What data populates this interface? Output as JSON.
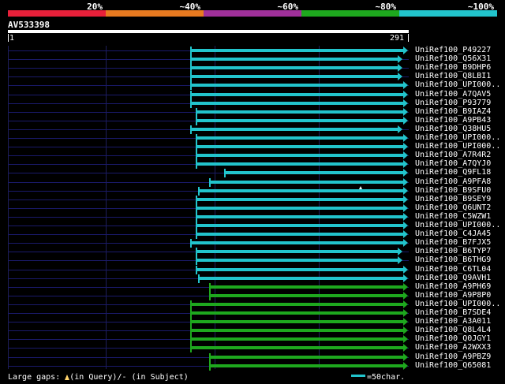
{
  "legend": {
    "segments": [
      {
        "label": "20%",
        "color": "#e8203a"
      },
      {
        "label": "~40%",
        "color": "#e87a20"
      },
      {
        "label": "~60%",
        "color": "#a0309a"
      },
      {
        "label": "~80%",
        "color": "#1ea81e"
      },
      {
        "label": "~100%",
        "color": "#22c4cc"
      }
    ]
  },
  "query": {
    "name": "AV533398",
    "start": "1",
    "end": "291"
  },
  "hits": [
    {
      "name": "UniRef100_P49227",
      "start": 133,
      "end": 291,
      "color": "cyan"
    },
    {
      "name": "UniRef100_Q56X31",
      "start": 133,
      "end": 287,
      "color": "cyan"
    },
    {
      "name": "UniRef100_B9DHP6",
      "start": 133,
      "end": 287,
      "color": "cyan"
    },
    {
      "name": "UniRef100_Q8LBI1",
      "start": 133,
      "end": 287,
      "color": "cyan"
    },
    {
      "name": "UniRef100_UPI000..",
      "start": 133,
      "end": 291,
      "color": "cyan"
    },
    {
      "name": "UniRef100_A7QAV5",
      "start": 133,
      "end": 291,
      "color": "cyan"
    },
    {
      "name": "UniRef100_P93779",
      "start": 133,
      "end": 291,
      "color": "cyan"
    },
    {
      "name": "UniRef100_B9IAZ4",
      "start": 137,
      "end": 291,
      "color": "cyan"
    },
    {
      "name": "UniRef100_A9PB43",
      "start": 137,
      "end": 291,
      "color": "cyan"
    },
    {
      "name": "UniRef100_Q38HU5",
      "start": 133,
      "end": 287,
      "color": "cyan"
    },
    {
      "name": "UniRef100_UPI000..",
      "start": 137,
      "end": 291,
      "color": "cyan"
    },
    {
      "name": "UniRef100_UPI000..",
      "start": 137,
      "end": 291,
      "color": "cyan"
    },
    {
      "name": "UniRef100_A7R4R2",
      "start": 137,
      "end": 291,
      "color": "cyan"
    },
    {
      "name": "UniRef100_A7QYJ0",
      "start": 137,
      "end": 291,
      "color": "cyan"
    },
    {
      "name": "UniRef100_Q9FL18",
      "start": 158,
      "end": 291,
      "color": "cyan"
    },
    {
      "name": "UniRef100_A9PFA8",
      "start": 147,
      "end": 291,
      "color": "cyan"
    },
    {
      "name": "UniRef100_B9SFU0",
      "start": 139,
      "end": 291,
      "color": "cyan"
    },
    {
      "name": "UniRef100_B9SEY9",
      "start": 137,
      "end": 291,
      "color": "cyan"
    },
    {
      "name": "UniRef100_Q6UNT2",
      "start": 137,
      "end": 291,
      "color": "cyan"
    },
    {
      "name": "UniRef100_C5WZW1",
      "start": 137,
      "end": 291,
      "color": "cyan"
    },
    {
      "name": "UniRef100_UPI000..",
      "start": 137,
      "end": 291,
      "color": "cyan"
    },
    {
      "name": "UniRef100_C4JA45",
      "start": 137,
      "end": 291,
      "color": "cyan"
    },
    {
      "name": "UniRef100_B7FJX5",
      "start": 133,
      "end": 291,
      "color": "cyan"
    },
    {
      "name": "UniRef100_B6TYP7",
      "start": 137,
      "end": 287,
      "color": "cyan"
    },
    {
      "name": "UniRef100_B6THG9",
      "start": 137,
      "end": 287,
      "color": "cyan"
    },
    {
      "name": "UniRef100_C6TL04",
      "start": 137,
      "end": 291,
      "color": "cyan"
    },
    {
      "name": "UniRef100_Q9AVH1",
      "start": 139,
      "end": 291,
      "color": "cyan"
    },
    {
      "name": "UniRef100_A9PH69",
      "start": 147,
      "end": 291,
      "color": "green"
    },
    {
      "name": "UniRef100_A9P8P0",
      "start": 147,
      "end": 291,
      "color": "green"
    },
    {
      "name": "UniRef100_UPI000..",
      "start": 133,
      "end": 291,
      "color": "green"
    },
    {
      "name": "UniRef100_B7SDE4",
      "start": 133,
      "end": 291,
      "color": "green"
    },
    {
      "name": "UniRef100_A3A011",
      "start": 133,
      "end": 291,
      "color": "green"
    },
    {
      "name": "UniRef100_Q8L4L4",
      "start": 133,
      "end": 291,
      "color": "green"
    },
    {
      "name": "UniRef100_Q0JGY1",
      "start": 133,
      "end": 291,
      "color": "green"
    },
    {
      "name": "UniRef100_A2WXX3",
      "start": 133,
      "end": 291,
      "color": "green"
    },
    {
      "name": "UniRef100_A9PBZ9",
      "start": 147,
      "end": 291,
      "color": "green"
    },
    {
      "name": "UniRef100_Q65081",
      "start": 147,
      "end": 291,
      "color": "green"
    }
  ],
  "colors": {
    "cyan": "#22c4cc",
    "green": "#1ea81e",
    "query_bar": "#ffffff",
    "gridline": "#1e1e5a"
  },
  "footer": {
    "prefix": "Large gaps: ",
    "query_part": "(in Query)/- (in Subject)",
    "scale_label": "=50char."
  }
}
